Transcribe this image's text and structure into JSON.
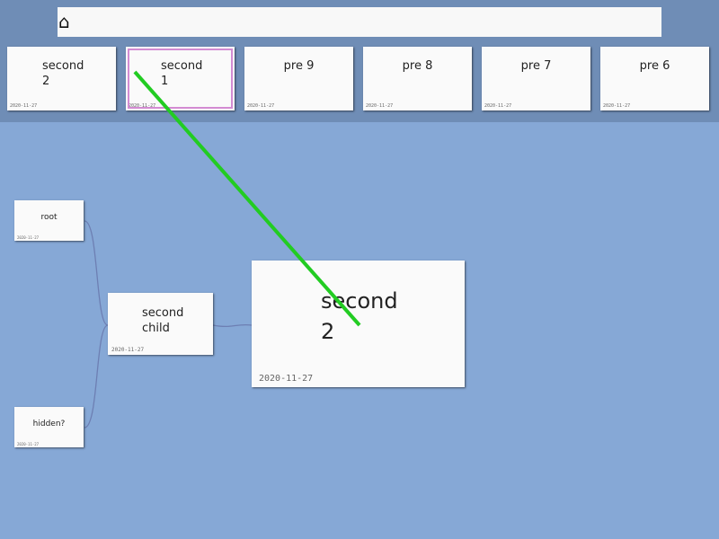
{
  "home_icon": "⌂",
  "search": {
    "value": "",
    "placeholder": ""
  },
  "recent": [
    {
      "title": "second\n2",
      "date": "2020-11-27"
    },
    {
      "title": "second\n1",
      "date": "2020-11-27",
      "selected": true
    },
    {
      "title": "pre 9",
      "date": "2020-11-27"
    },
    {
      "title": "pre 8",
      "date": "2020-11-27"
    },
    {
      "title": "pre 7",
      "date": "2020-11-27"
    },
    {
      "title": "pre 6",
      "date": "2020-11-27"
    }
  ],
  "graph": {
    "root": {
      "title": "root",
      "date": "2020-11-27"
    },
    "hidden": {
      "title": "hidden?",
      "date": "2020-11-27"
    },
    "second_child": {
      "title": "second\nchild",
      "date": "2020-11-27"
    },
    "current": {
      "title": "second\n2",
      "date": "2020-11-27"
    }
  },
  "colors": {
    "background": "#86a8d6",
    "top_bar": "#6f8db6",
    "selection_border": "#d38bd2",
    "drag_line": "#22cc22",
    "edge": "#6d7fb3"
  }
}
